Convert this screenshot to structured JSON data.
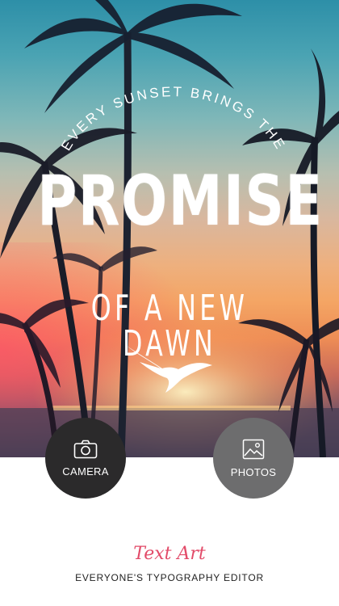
{
  "hero": {
    "quote_line1": "EVERY SUNSET BRINGS THE",
    "quote_line2": "PROMISE",
    "quote_line3": "OF A NEW DAWN"
  },
  "actions": {
    "camera": {
      "label": "CAMERA",
      "icon": "camera-icon"
    },
    "photos": {
      "label": "PHOTOS",
      "icon": "image-icon"
    }
  },
  "footer": {
    "brand": "Text Art",
    "tagline": "EVERYONE'S TYPOGRAPHY EDITOR"
  },
  "colors": {
    "brand": "#e24b69",
    "camera_button": "#2b2a2b",
    "photos_button": "#6d6d6e"
  }
}
